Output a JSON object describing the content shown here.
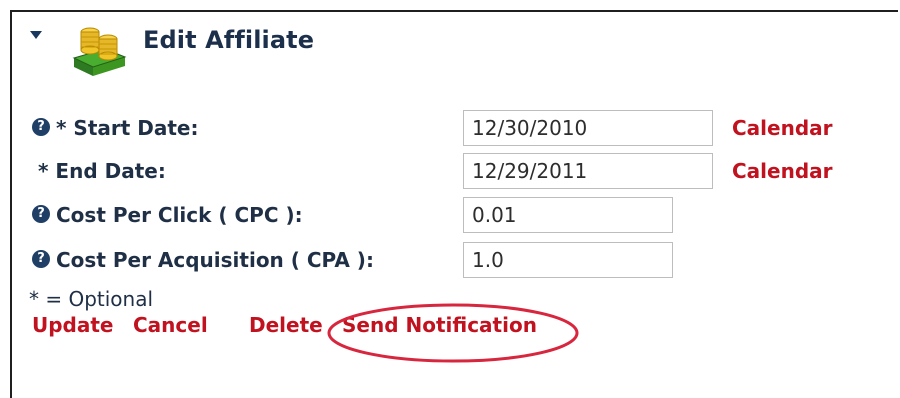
{
  "header": {
    "title": "Edit Affiliate"
  },
  "form": {
    "start_date": {
      "label": "* Start Date:",
      "value": "12/30/2010",
      "calendar_label": "Calendar"
    },
    "end_date": {
      "label": "* End Date:",
      "value": "12/29/2011",
      "calendar_label": "Calendar"
    },
    "cost_per_click": {
      "label": "Cost Per Click ( CPC ):",
      "value": "0.01"
    },
    "cost_per_acquisition": {
      "label": "Cost Per Acquisition ( CPA ):",
      "value": "1.0"
    }
  },
  "footer": {
    "optional_note": "* = Optional",
    "actions": [
      {
        "label": "Update"
      },
      {
        "label": "Cancel"
      },
      {
        "label": "Delete"
      },
      {
        "label": "Send Notification"
      }
    ]
  },
  "colors": {
    "link": "#c1121f",
    "label": "#1f2f46",
    "title": "#1c2f4b",
    "highlight": "#d7263d",
    "border": "#1f1f1f"
  }
}
